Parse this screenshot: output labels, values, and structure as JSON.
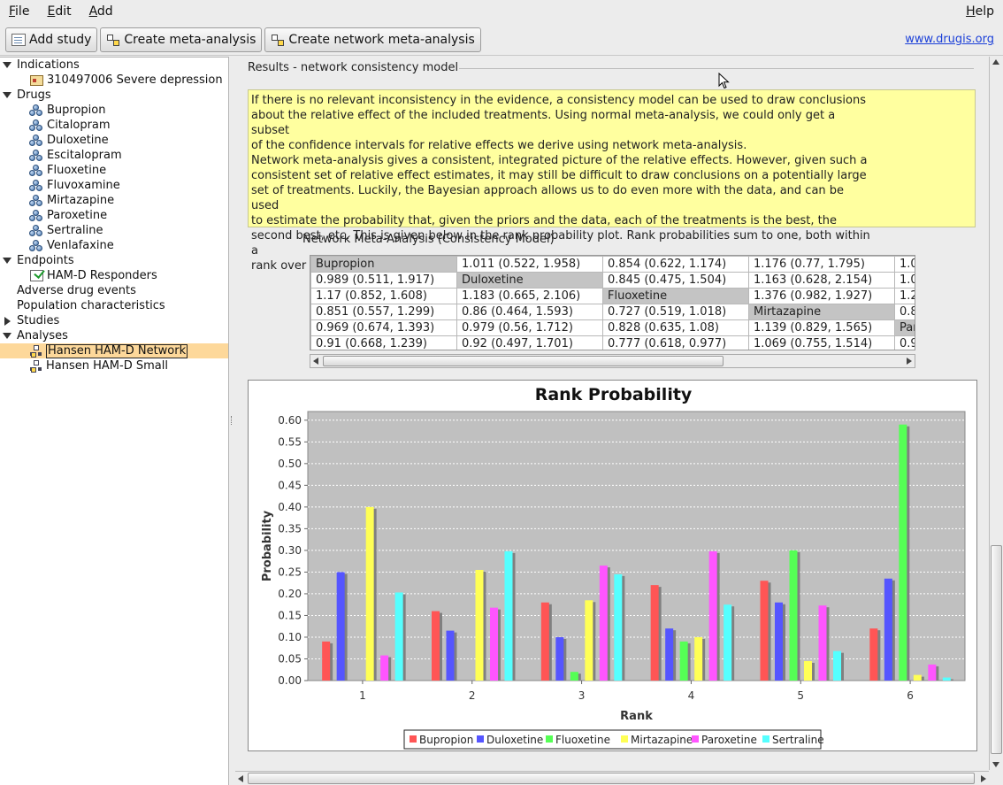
{
  "menubar": {
    "file": {
      "mnemonic": "F",
      "rest": "ile"
    },
    "edit": {
      "mnemonic": "E",
      "rest": "dit"
    },
    "add": {
      "mnemonic": "A",
      "rest": "dd"
    },
    "help": {
      "mnemonic": "H",
      "rest": "elp"
    }
  },
  "toolbar": {
    "add_study": "Add study",
    "create_meta": "Create meta-analysis",
    "create_network": "Create network meta-analysis",
    "site_link": "www.drugis.org"
  },
  "tree": {
    "indications": {
      "label": "Indications",
      "children": [
        "310497006 Severe depression"
      ]
    },
    "drugs": {
      "label": "Drugs",
      "children": [
        "Bupropion",
        "Citalopram",
        "Duloxetine",
        "Escitalopram",
        "Fluoxetine",
        "Fluvoxamine",
        "Mirtazapine",
        "Paroxetine",
        "Sertraline",
        "Venlafaxine"
      ]
    },
    "endpoints": {
      "label": "Endpoints",
      "children": [
        "HAM-D Responders"
      ]
    },
    "adverse": "Adverse drug events",
    "population": "Population characteristics",
    "studies": "Studies",
    "analyses": {
      "label": "Analyses",
      "children": [
        "Hansen HAM-D Network",
        "Hansen HAM-D Small"
      ]
    }
  },
  "results": {
    "section_title": "Results - network consistency model",
    "info_lines": [
      "If there is no relevant inconsistency in the evidence, a consistency model can be used to draw conclusions",
      "about the relative effect of the included treatments. Using normal meta-analysis, we could only get a subset",
      "of the confidence intervals for relative effects we derive using network meta-analysis.",
      "Network meta-analysis gives a consistent, integrated picture of the relative effects. However, given such a",
      "consistent set of relative effect estimates, it may still be difficult to draw conclusions on a potentially large",
      "set of treatments. Luckily, the Bayesian approach allows us to do even more with the data, and can be used",
      "to estimate the probability that, given the priors and the data, each of the treatments is the best, the",
      "second best, etc. This is given below in the rank probability plot. Rank probabilities sum to one, both within a",
      "rank over treatments and within a treatment over ranks."
    ],
    "nma_title": "Network Meta-Analysis (Consistency Model)",
    "nma_rows": [
      [
        "Bupropion",
        "1.011 (0.522, 1.958)",
        "0.854 (0.622, 1.174)",
        "1.176 (0.77, 1.795)",
        "1.0"
      ],
      [
        "0.989 (0.511, 1.917)",
        "Duloxetine",
        "0.845 (0.475, 1.504)",
        "1.163 (0.628, 2.154)",
        "1.0"
      ],
      [
        "1.17 (0.852, 1.608)",
        "1.183 (0.665, 2.106)",
        "Fluoxetine",
        "1.376 (0.982, 1.927)",
        "1.2"
      ],
      [
        "0.851 (0.557, 1.299)",
        "0.86 (0.464, 1.593)",
        "0.727 (0.519, 1.018)",
        "Mirtazapine",
        "0.8"
      ],
      [
        "0.969 (0.674, 1.393)",
        "0.979 (0.56, 1.712)",
        "0.828 (0.635, 1.08)",
        "1.139 (0.829, 1.565)",
        "Par"
      ],
      [
        "0.91 (0.668, 1.239)",
        "0.92 (0.497, 1.701)",
        "0.777 (0.618, 0.977)",
        "1.069 (0.755, 1.514)",
        "0.9"
      ]
    ],
    "nma_diag": [
      [
        0,
        0
      ],
      [
        1,
        1
      ],
      [
        2,
        2
      ],
      [
        3,
        3
      ],
      [
        4,
        4
      ]
    ]
  },
  "chart_data": {
    "type": "bar",
    "title": "Rank Probability",
    "xlabel": "Rank",
    "ylabel": "Probability",
    "categories": [
      "1",
      "2",
      "3",
      "4",
      "5",
      "6"
    ],
    "ylim": [
      0,
      0.62
    ],
    "yticks": [
      "0.00",
      "0.05",
      "0.10",
      "0.15",
      "0.20",
      "0.25",
      "0.30",
      "0.35",
      "0.40",
      "0.45",
      "0.50",
      "0.55",
      "0.60"
    ],
    "grid": true,
    "legend_position": "bottom",
    "series": [
      {
        "name": "Bupropion",
        "color": "#ff5555",
        "values": [
          0.09,
          0.16,
          0.18,
          0.22,
          0.23,
          0.12
        ]
      },
      {
        "name": "Duloxetine",
        "color": "#5555ff",
        "values": [
          0.25,
          0.115,
          0.1,
          0.12,
          0.18,
          0.235
        ]
      },
      {
        "name": "Fluoxetine",
        "color": "#55ff55",
        "values": [
          0.0,
          0.0,
          0.02,
          0.09,
          0.3,
          0.59
        ]
      },
      {
        "name": "Mirtazapine",
        "color": "#ffff55",
        "values": [
          0.4,
          0.255,
          0.185,
          0.1,
          0.045,
          0.013
        ]
      },
      {
        "name": "Paroxetine",
        "color": "#ff55ff",
        "values": [
          0.058,
          0.168,
          0.265,
          0.298,
          0.173,
          0.037
        ]
      },
      {
        "name": "Sertraline",
        "color": "#55ffff",
        "values": [
          0.203,
          0.298,
          0.245,
          0.175,
          0.068,
          0.007
        ]
      }
    ]
  }
}
